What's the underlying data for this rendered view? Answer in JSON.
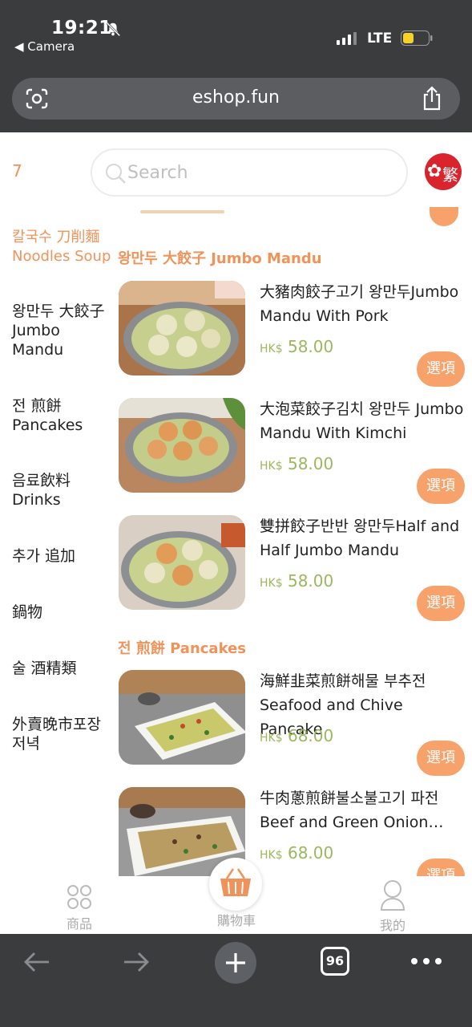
{
  "status_bar": {
    "time": "19:21",
    "back_label": "◀ Camera",
    "network": "LTE"
  },
  "browser": {
    "url": "eshop.fun",
    "tab_count": "96"
  },
  "header": {
    "cart_count": "7",
    "search_placeholder": "Search",
    "language_label": "繁"
  },
  "categories": {
    "current_line1": "칼국수 刀削麵",
    "current_line2": "Noodles Soup",
    "items": [
      {
        "label": "왕만두 大餃子\nJumbo\nMandu"
      },
      {
        "label": "전 煎餅\nPancakes"
      },
      {
        "label": "음료飲料\nDrinks"
      },
      {
        "label": "추가 追加"
      },
      {
        "label": "鍋物"
      },
      {
        "label": "술 酒精類"
      },
      {
        "label": "外賣晚市포장\n저녁"
      }
    ]
  },
  "sections": [
    {
      "title": "왕만두 大餃子 Jumbo Mandu"
    },
    {
      "title": "전 煎餅 Pancakes"
    }
  ],
  "products": [
    {
      "name": "大豬肉餃子고기 왕만두Jumbo Mandu With Pork",
      "currency": "HK$",
      "price": "58.00",
      "button": "選項"
    },
    {
      "name": "大泡菜餃子김치 왕만두 Jumbo Mandu With Kimchi",
      "currency": "HK$",
      "price": "58.00",
      "button": "選項"
    },
    {
      "name": "雙拼餃子반반 왕만두Half and Half Jumbo Mandu",
      "currency": "HK$",
      "price": "58.00",
      "button": "選項"
    },
    {
      "name": "海鮮韭菜煎餅해물 부추전 Seafood and Chive Pancake",
      "currency": "HK$",
      "price": "68.00",
      "button": "選項"
    },
    {
      "name": "牛肉蔥煎餅불소불고기 파전 Beef and Green Onion…",
      "currency": "HK$",
      "price": "68.00",
      "button": "選項"
    }
  ],
  "tabbar": {
    "products": "商品",
    "cart": "購物車",
    "mine": "我的"
  },
  "colors": {
    "accent": "#f7a26a",
    "price": "#9bb85e",
    "chrome": "#3a3c3e"
  }
}
